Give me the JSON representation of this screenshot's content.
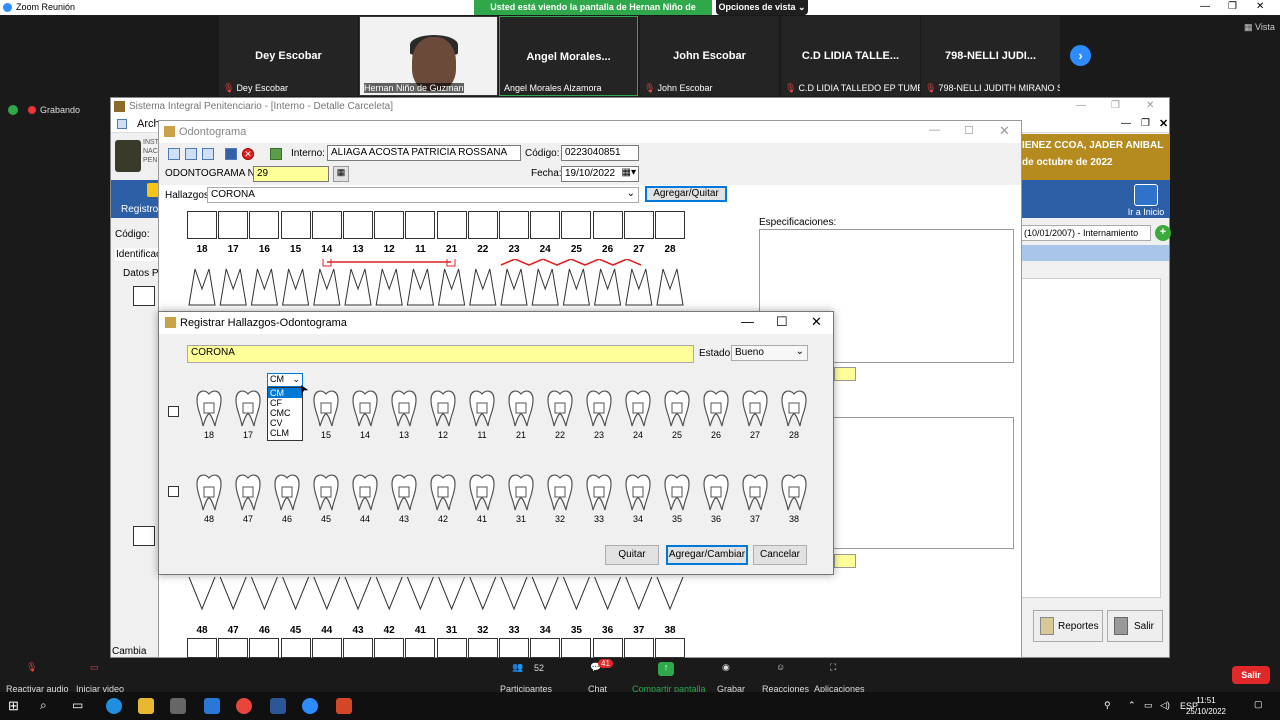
{
  "zoom": {
    "window_title": "Zoom Reunión",
    "share_banner": "Usted está viendo la pantalla de Hernan Niño de Guzman",
    "view_options": "Opciones de vista",
    "gallery_view": "Vista",
    "recording": "Grabando",
    "participants": [
      {
        "tile_name": "Dey Escobar",
        "label": "Dey Escobar",
        "muted": true
      },
      {
        "tile_name": "",
        "label": "Hernan Niño de Guzman",
        "muted": false
      },
      {
        "tile_name": "Angel  Morales...",
        "label": "Angel Morales Alzamora",
        "muted": false
      },
      {
        "tile_name": "John Escobar",
        "label": "John Escobar",
        "muted": true
      },
      {
        "tile_name": "C.D LIDIA TALLE...",
        "label": "C.D LIDIA TALLEDO EP TUMBES",
        "muted": true
      },
      {
        "tile_name": "798-NELLI JUDI...",
        "label": "798-NELLI JUDITH MIRANO S...",
        "muted": true
      }
    ],
    "controls": {
      "audio": "Reactivar audio",
      "video": "Iniciar video",
      "participants_label": "Participantes",
      "participants_count": "52",
      "chat": "Chat",
      "chat_badge": "41",
      "share": "Compartir pantalla",
      "record": "Grabar",
      "reactions": "Reacciones",
      "apps": "Aplicaciones",
      "leave": "Salir"
    }
  },
  "app": {
    "title": "Sistema Integral Penitenciario - [Interno - Detalle Carceleta]",
    "menu_file": "Arch",
    "banner_line1": "IENEZ CCOA, JADER ANIBAL",
    "banner_line2": "de octubre de 2022",
    "home": "Ir a Inicio",
    "intern_combo": "(10/01/2007) - Internamiento",
    "reports": "Reportes",
    "exit": "Salir",
    "left_register": "Registro",
    "left_code": "Código:",
    "left_ident": "Identificaci",
    "left_data": "Datos Pe",
    "left_change": "Cambia"
  },
  "odontograma": {
    "title": "Odontograma",
    "interno_label": "Interno:",
    "interno_value": "ALIAGA ACOSTA PATRICIA ROSSANA",
    "codigo_label": "Código:",
    "codigo_value": "0223040851",
    "numero_label": "ODONTOGRAMA N°:",
    "numero_value": "29",
    "fecha_label": "Fecha:",
    "fecha_value": "19/10/2022",
    "hallazgos_label": "Hallazgos",
    "hallazgos_value": "CORONA",
    "add_remove": "Agregar/Quitar",
    "spec_label": "Especificaciones:",
    "upper_numbers": [
      "18",
      "17",
      "16",
      "15",
      "14",
      "13",
      "12",
      "11",
      "21",
      "22",
      "23",
      "24",
      "25",
      "26",
      "27",
      "28"
    ],
    "lower_numbers": [
      "48",
      "47",
      "46",
      "45",
      "44",
      "43",
      "42",
      "41",
      "31",
      "32",
      "33",
      "34",
      "35",
      "36",
      "37",
      "38"
    ]
  },
  "dialog": {
    "title": "Registrar Hallazgos-Odontograma",
    "hallazgo": "CORONA",
    "estado_label": "Estado",
    "estado_value": "Bueno",
    "dropdown_value": "CM",
    "dropdown_options": [
      "CM",
      "CF",
      "CMC",
      "CV",
      "CLM"
    ],
    "dropdown_selected_index": 0,
    "upper_numbers": [
      "18",
      "17",
      "15",
      "14",
      "13",
      "12",
      "11",
      "21",
      "22",
      "23",
      "24",
      "25",
      "26",
      "27",
      "28"
    ],
    "lower_numbers": [
      "48",
      "47",
      "46",
      "45",
      "44",
      "43",
      "42",
      "41",
      "31",
      "32",
      "33",
      "34",
      "35",
      "36",
      "37",
      "38"
    ],
    "buttons": {
      "remove": "Quitar",
      "add": "Agregar/Cambiar",
      "cancel": "Cancelar"
    }
  },
  "taskbar": {
    "language": "ESP",
    "time": "11:51",
    "date": "25/10/2022"
  }
}
